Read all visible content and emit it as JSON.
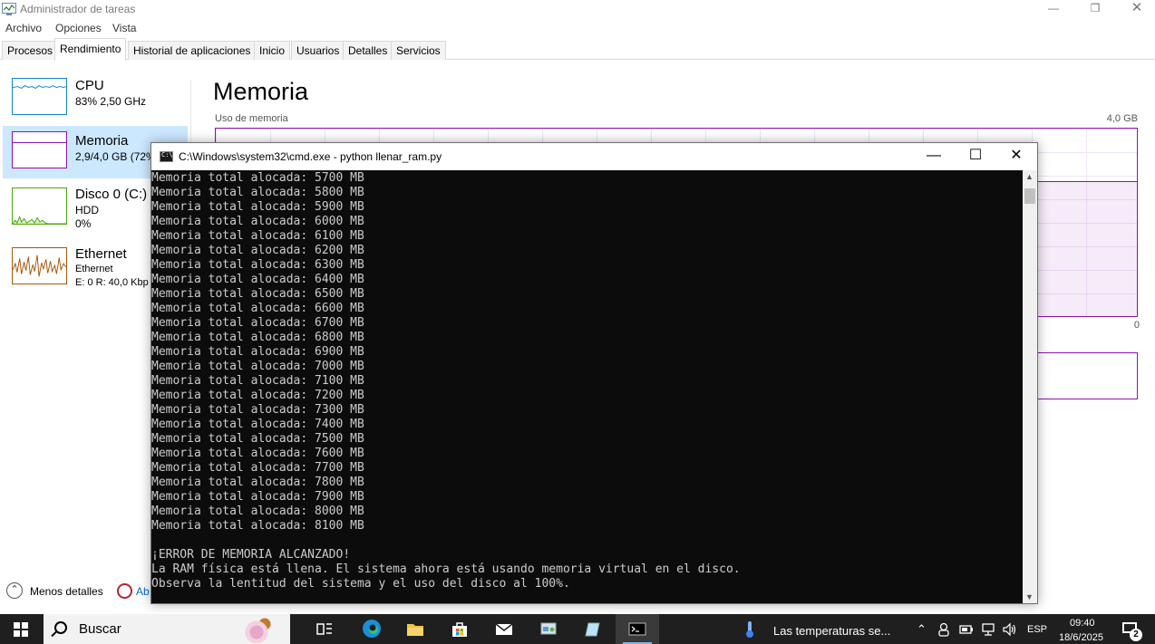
{
  "task_manager": {
    "title": "Administrador de tareas",
    "menu": [
      "Archivo",
      "Opciones",
      "Vista"
    ],
    "tabs": [
      "Procesos",
      "Rendimiento",
      "Historial de aplicaciones",
      "Inicio",
      "Usuarios",
      "Detalles",
      "Servicios"
    ],
    "active_tab": "Rendimiento",
    "side": {
      "cpu": {
        "name": "CPU",
        "detail": "83% 2,50 GHz"
      },
      "memory": {
        "name": "Memoria",
        "detail": "2,9/4,0 GB (72%"
      },
      "disk": {
        "name": "Disco 0 (C:)",
        "type": "HDD",
        "usage": "0%"
      },
      "ethernet": {
        "name": "Ethernet",
        "label": "Ethernet",
        "detail": "E: 0 R: 40,0 Kbp"
      }
    },
    "main": {
      "title": "Memoria",
      "usage_label": "Uso de memoria",
      "max_label": "4,0 GB",
      "min_label": "0",
      "usage_level": 0.72
    },
    "footer": {
      "less_details": "Menos detalles",
      "monitor_link": "Ab"
    }
  },
  "cmd": {
    "title": "C:\\Windows\\system32\\cmd.exe - python  llenar_ram.py",
    "lines": [
      "Memoria total alocada: 5700 MB",
      "Memoria total alocada: 5800 MB",
      "Memoria total alocada: 5900 MB",
      "Memoria total alocada: 6000 MB",
      "Memoria total alocada: 6100 MB",
      "Memoria total alocada: 6200 MB",
      "Memoria total alocada: 6300 MB",
      "Memoria total alocada: 6400 MB",
      "Memoria total alocada: 6500 MB",
      "Memoria total alocada: 6600 MB",
      "Memoria total alocada: 6700 MB",
      "Memoria total alocada: 6800 MB",
      "Memoria total alocada: 6900 MB",
      "Memoria total alocada: 7000 MB",
      "Memoria total alocada: 7100 MB",
      "Memoria total alocada: 7200 MB",
      "Memoria total alocada: 7300 MB",
      "Memoria total alocada: 7400 MB",
      "Memoria total alocada: 7500 MB",
      "Memoria total alocada: 7600 MB",
      "Memoria total alocada: 7700 MB",
      "Memoria total alocada: 7800 MB",
      "Memoria total alocada: 7900 MB",
      "Memoria total alocada: 8000 MB",
      "Memoria total alocada: 8100 MB",
      "",
      "¡ERROR DE MEMORIA ALCANZADO!",
      "La RAM física está llena. El sistema ahora está usando memoria virtual en el disco.",
      "Observa la lentitud del sistema y el uso del disco al 100%."
    ]
  },
  "taskbar": {
    "search_placeholder": "Buscar",
    "weather": "Las temperaturas se...",
    "language": "ESP",
    "time": "09:40",
    "date": "18/6/2025",
    "notifications": "2"
  },
  "colors": {
    "memory_accent": "#8b12ae",
    "cpu_accent": "#1183c6",
    "disk_accent": "#4da60c",
    "ethernet_accent": "#a7570b",
    "selected_bg": "#cce8ff"
  }
}
